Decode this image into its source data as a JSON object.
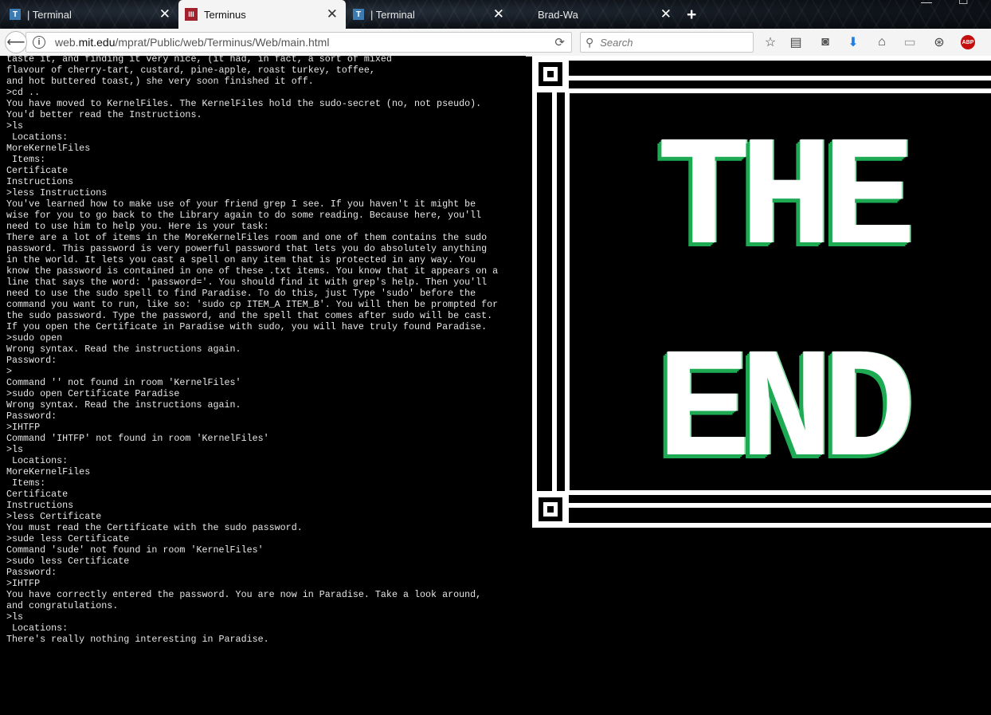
{
  "tabs": [
    {
      "label": "| Terminal",
      "active": false
    },
    {
      "label": "Terminus",
      "active": true
    },
    {
      "label": "| Terminal",
      "active": false
    },
    {
      "label": "Brad-Wa",
      "active": false
    }
  ],
  "favicons": {
    "terminal": "T",
    "terminus": "III"
  },
  "navbar": {
    "url_prefix": "web.",
    "url_domain": "mit.edu",
    "url_path": "/mprat/Public/web/Terminus/Web/main.html",
    "search_placeholder": "Search"
  },
  "terminal": {
    "lines": [
      "taste it, and finding it very nice, (it had, in fact, a sort of mixed",
      "flavour of cherry-tart, custard, pine-apple, roast turkey, toffee,",
      "and hot buttered toast,) she very soon finished it off.",
      ">cd ..",
      "You have moved to KernelFiles. The KernelFiles hold the sudo-secret (no, not pseudo).",
      "You'd better read the Instructions.",
      ">ls",
      " Locations:",
      "MoreKernelFiles",
      " Items:",
      "Certificate",
      "Instructions",
      ">less Instructions",
      "You've learned how to make use of your friend grep I see. If you haven't it might be",
      "wise for you to go back to the Library again to do some reading. Because here, you'll",
      "need to use him to help you. Here is your task:",
      "There are a lot of items in the MoreKernelFiles room and one of them contains the sudo",
      "password. This password is very powerful password that lets you do absolutely anything",
      "in the world. It lets you cast a spell on any item that is protected in any way. You",
      "know the password is contained in one of these .txt items. You know that it appears on a",
      "line that says the word: 'password='. You should find it with grep's help. Then you'll",
      "need to use the sudo spell to find Paradise. To do this, just Type 'sudo' before the",
      "command you want to run, like so: 'sudo cp ITEM_A ITEM_B'. You will then be prompted for",
      "the sudo password. Type the password, and the spell that comes after sudo will be cast.",
      "If you open the Certificate in Paradise with sudo, you will have truly found Paradise.",
      ">sudo open",
      "Wrong syntax. Read the instructions again.",
      "Password:",
      ">",
      "Command '' not found in room 'KernelFiles'",
      ">sudo open Certificate Paradise",
      "Wrong syntax. Read the instructions again.",
      "Password:",
      ">IHTFP",
      "Command 'IHTFP' not found in room 'KernelFiles'",
      ">ls",
      " Locations:",
      "MoreKernelFiles",
      " Items:",
      "Certificate",
      "Instructions",
      ">less Certificate",
      "You must read the Certificate with the sudo password.",
      ">sude less Certificate",
      "Command 'sude' not found in room 'KernelFiles'",
      ">sudo less Certificate",
      "Password:",
      ">IHTFP",
      "You have correctly entered the password. You are now in Paradise. Take a look around,",
      "and congratulations.",
      ">ls",
      " Locations:",
      "There's really nothing interesting in Paradise."
    ]
  },
  "end_image": {
    "word1": "THE",
    "word2": "END",
    "text_color": "#ffffff",
    "shadow_color": "#1eaa52"
  }
}
